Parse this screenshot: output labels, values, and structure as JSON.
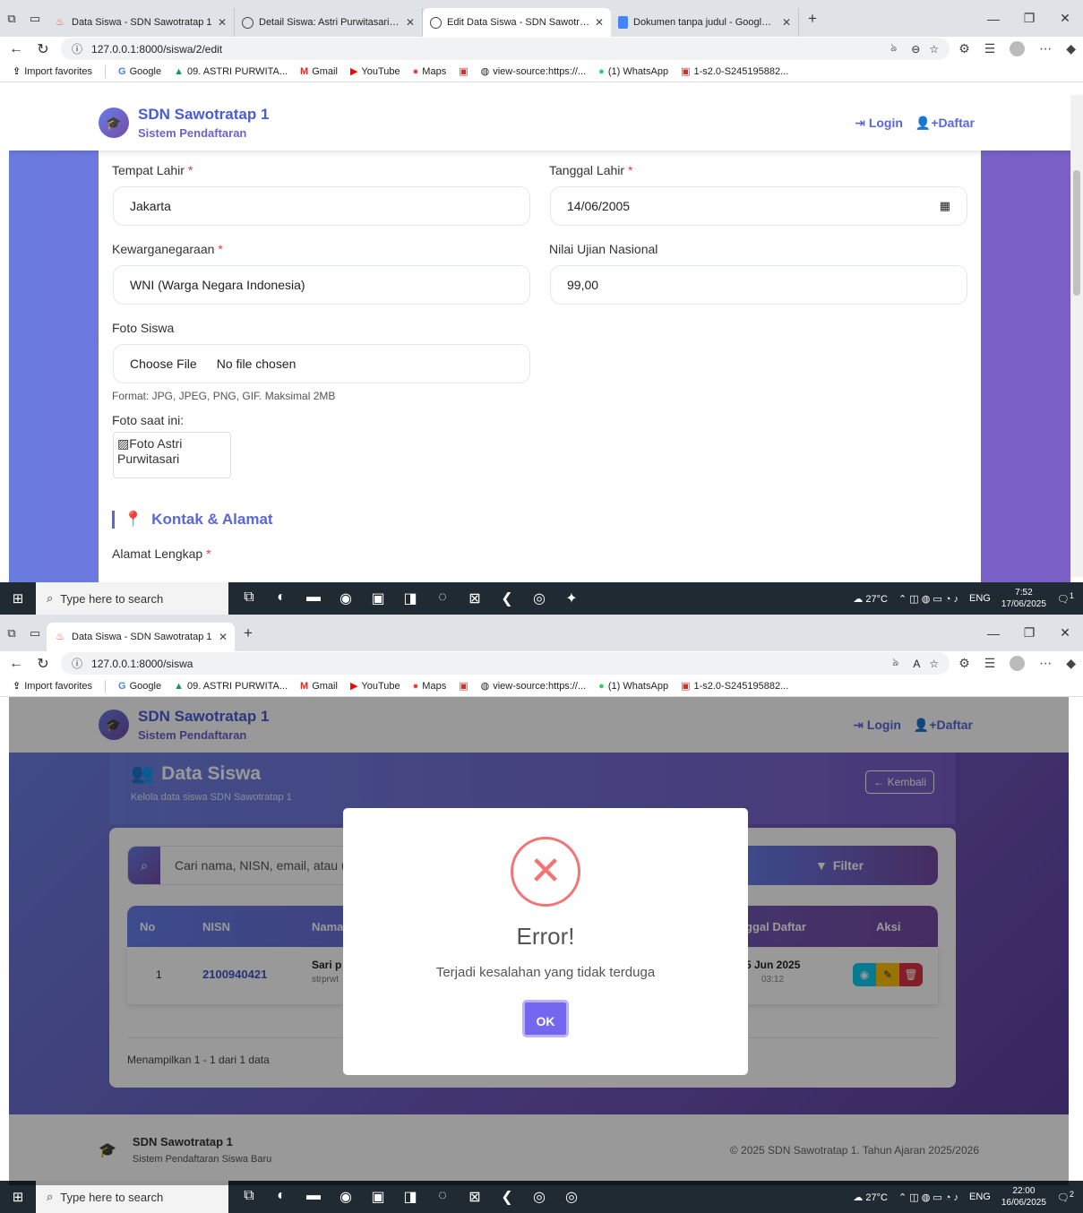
{
  "screen1": {
    "tabs": [
      {
        "title": "Data Siswa - SDN Sawotratap 1",
        "favicon": "laravel-icon"
      },
      {
        "title": "Detail Siswa: Astri Purwitasari - SD",
        "favicon": "globe-icon"
      },
      {
        "title": "Edit Data Siswa - SDN Sawotratap",
        "favicon": "globe-icon",
        "active": true
      },
      {
        "title": "Dokumen tanpa judul - Google D",
        "favicon": "docs-icon"
      }
    ],
    "url": "127.0.0.1:8000/siswa/2/edit",
    "form": {
      "tempat_lahir_label": "Tempat Lahir",
      "tempat_lahir_value": "Jakarta",
      "tanggal_lahir_label": "Tanggal Lahir",
      "tanggal_lahir_value": "14/06/2005",
      "kewarganegaraan_label": "Kewarganegaraan",
      "kewarganegaraan_value": "WNI (Warga Negara Indonesia)",
      "nilai_label": "Nilai Ujian Nasional",
      "nilai_value": "99,00",
      "foto_label": "Foto Siswa",
      "choose_file": "Choose File",
      "no_file": "No file chosen",
      "format_hint": "Format: JPG, JPEG, PNG, GIF. Maksimal 2MB",
      "foto_saat_ini": "Foto saat ini:",
      "foto_alt": "Foto Astri Purwitasari",
      "section_kontak": "Kontak & Alamat",
      "alamat_label": "Alamat Lengkap",
      "required_mark": "*"
    },
    "taskbar": {
      "temp": "27°C",
      "time": "7:52",
      "date": "17/06/2025",
      "lang": "ENG",
      "notif": "1"
    }
  },
  "screen2": {
    "tabs": [
      {
        "title": "Data Siswa - SDN Sawotratap 1",
        "favicon": "laravel-icon",
        "active": true
      }
    ],
    "url": "127.0.0.1:8000/siswa",
    "header": {
      "title": "Data Siswa",
      "subtitle": "Kelola data siswa SDN Sawotratap 1",
      "back": "Kembali"
    },
    "search_placeholder": "Cari nama, NISN, email, atau u",
    "filter_label": "Filter",
    "table": {
      "columns": [
        "No",
        "NISN",
        "Nama",
        "ggal Daftar",
        "Aksi"
      ],
      "rows": [
        {
          "no": "1",
          "nisn": "2100940421",
          "nama": "Sari p",
          "sub": "strprwt",
          "tanggal": "5 Jun 2025",
          "jam": "03:12"
        }
      ]
    },
    "info": "Menampilkan 1 - 1 dari 1 data",
    "modal": {
      "title": "Error!",
      "message": "Terjadi kesalahan yang tidak terduga",
      "ok": "OK"
    },
    "footer": {
      "name": "SDN Sawotratap 1",
      "sub": "Sistem Pendaftaran Siswa Baru",
      "copyright": "© 2025 SDN Sawotratap 1. Tahun Ajaran 2025/2026"
    },
    "taskbar": {
      "temp": "27°C",
      "time": "22:00",
      "date": "16/06/2025",
      "lang": "ENG",
      "notif": "2"
    }
  },
  "common": {
    "bookmarks": [
      "Import favorites",
      "Google",
      "09. ASTRI PURWITA...",
      "Gmail",
      "YouTube",
      "Maps",
      "view-source:https://...",
      "(1) WhatsApp",
      "1-s2.0-S245195882..."
    ],
    "brand_name": "SDN Sawotratap 1",
    "brand_sub": "Sistem Pendaftaran",
    "login": "Login",
    "daftar": "Daftar",
    "search_taskbar": "Type here to search",
    "translate_glyph": "ঌ",
    "colors": {
      "accent": "#5a67d8",
      "gradient_start": "#667eea",
      "gradient_end": "#764ba2",
      "error": "#f27474",
      "ok_button": "#7367f0"
    }
  }
}
